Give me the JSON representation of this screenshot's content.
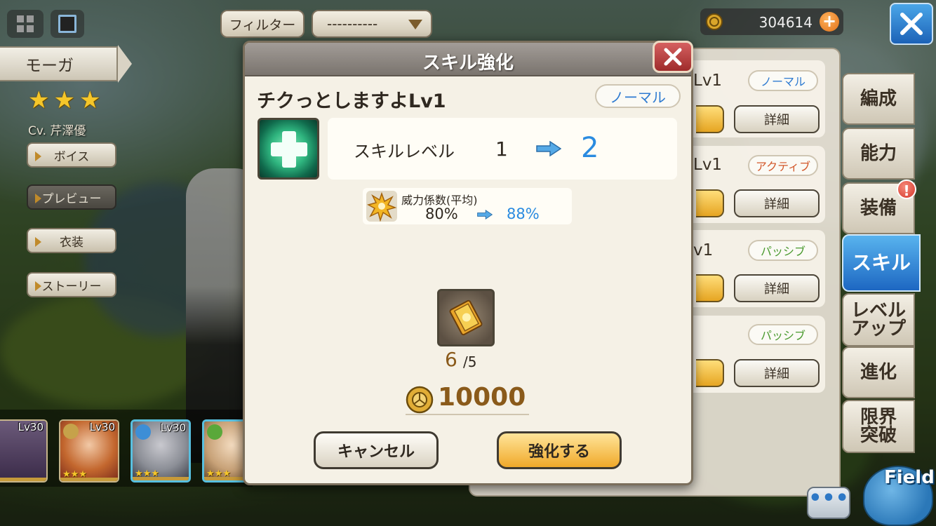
{
  "top_bar": {
    "filter_label": "フィルター",
    "filter_value": "----------",
    "currency_amount": "304614"
  },
  "character": {
    "name": "モーガ",
    "rarity_stars": 3,
    "voice_actor": "Cv. 芹澤優",
    "buttons": [
      "ボイス",
      "プレビュー",
      "衣装",
      "ストーリー"
    ]
  },
  "party": [
    {
      "level": "Lv30",
      "stars": "★★★"
    },
    {
      "level": "Lv30",
      "stars": "★★★"
    },
    {
      "level": "Lv30",
      "stars": "★★★"
    },
    {
      "level": "L",
      "stars": "★★★"
    }
  ],
  "skill_list": {
    "rows": [
      {
        "name_fragment": "Lv1",
        "type": "ノーマル",
        "detail": "詳細"
      },
      {
        "name_fragment": "Lv1",
        "type": "アクティブ",
        "detail": "詳細"
      },
      {
        "name_fragment": "v1",
        "type": "パッシブ",
        "detail": "詳細"
      },
      {
        "name_fragment": "",
        "type": "パッシブ",
        "detail": "詳細"
      }
    ]
  },
  "nav_tabs": [
    "編成",
    "能力",
    "装備",
    "スキル",
    "レベルアップ",
    "進化",
    "限界突破"
  ],
  "nav_tab_lines": {
    "levelup": [
      "レベル",
      "アップ"
    ],
    "limitbreak": [
      "限界",
      "突破"
    ]
  },
  "nav_selected": "スキル",
  "nav_alert": "!",
  "field_label": "Field",
  "chat_label": "•••",
  "modal": {
    "title": "スキル強化",
    "skill_name": "チクっとしますよLv1",
    "skill_type": "ノーマル",
    "level_label": "スキルレベル",
    "level_from": "1",
    "level_to": "2",
    "power_label": "威力係数(平均)",
    "power_from": "80%",
    "power_to": "88%",
    "item_count": "6",
    "item_required": "/5",
    "cost": "10000",
    "cancel_label": "キャンセル",
    "confirm_label": "強化する"
  },
  "colors": {
    "accent_blue": "#2a8be0",
    "gold": "#8a5a1a",
    "confirm_button": "#f0a92a",
    "selected_tab": "#1d67c2"
  }
}
